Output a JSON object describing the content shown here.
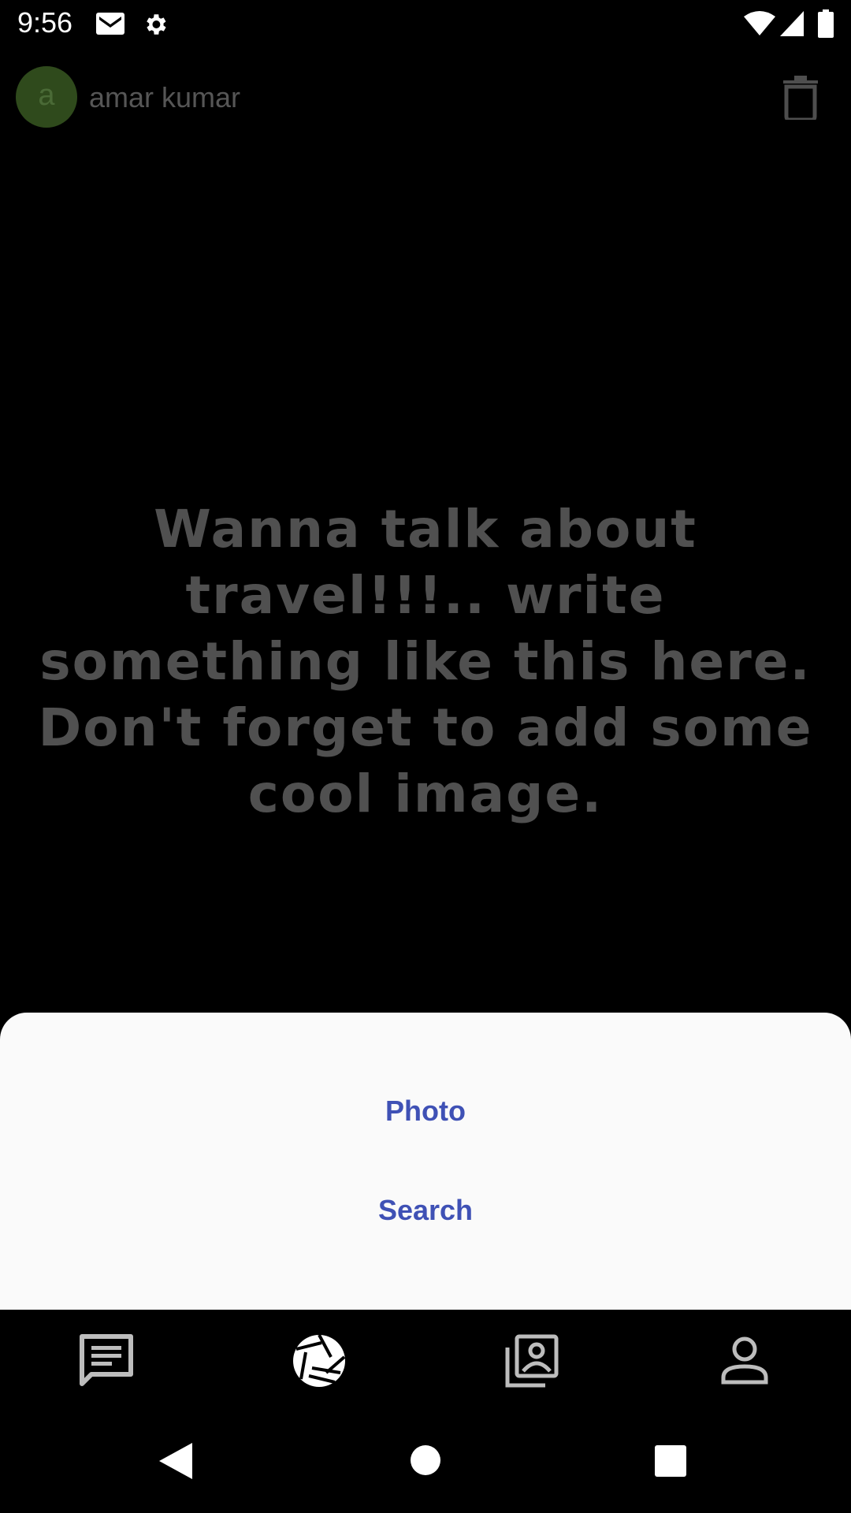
{
  "status_bar": {
    "time": "9:56",
    "icons": [
      "gmail-icon",
      "settings-icon",
      "wifi-icon",
      "cell-signal-icon",
      "battery-icon"
    ]
  },
  "header": {
    "avatar_letter": "a",
    "username": "amar kumar",
    "delete_icon": "trash-icon"
  },
  "prompt": {
    "text": "Wanna talk about travel!!!.. write something like this here. Don't forget to add some cool image."
  },
  "sheet": {
    "options": [
      {
        "label": "Photo"
      },
      {
        "label": "Search"
      }
    ]
  },
  "bottom_nav": {
    "items": [
      {
        "icon": "chat-icon"
      },
      {
        "icon": "camera-aperture-icon",
        "selected": true
      },
      {
        "icon": "photo-album-icon"
      },
      {
        "icon": "person-icon"
      }
    ]
  },
  "system_nav": [
    "back-icon",
    "home-icon",
    "recents-icon"
  ],
  "colors": {
    "background": "#000000",
    "avatar": "#2f4a1c",
    "prompt_text": "#505050",
    "sheet_bg": "#fafafa",
    "accent": "#3f51b5",
    "icon_dim": "#bdbdbd"
  }
}
